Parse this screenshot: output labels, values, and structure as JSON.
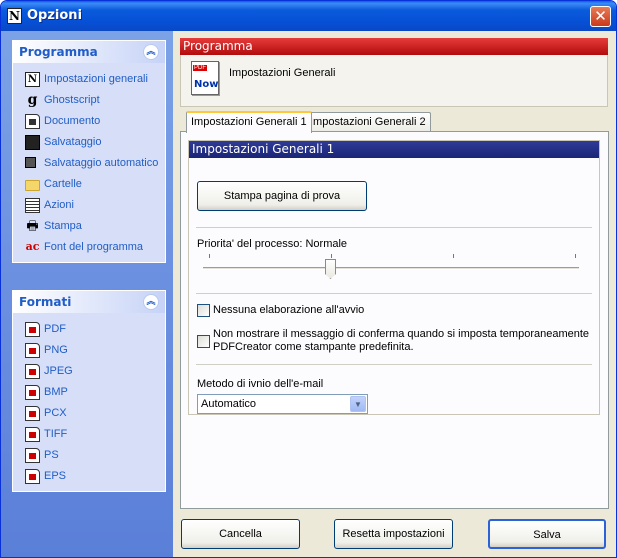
{
  "window": {
    "title": "Opzioni",
    "app_icon_glyph": "N",
    "close_glyph": "✕"
  },
  "nav": {
    "programma": {
      "title": "Programma",
      "items": [
        {
          "label": "Impostazioni generali",
          "icon": "document-n-icon"
        },
        {
          "label": "Ghostscript",
          "icon": "ghostscript-icon"
        },
        {
          "label": "Documento",
          "icon": "document-icon"
        },
        {
          "label": "Salvataggio",
          "icon": "floppy-disk-icon"
        },
        {
          "label": "Salvataggio automatico",
          "icon": "auto-save-icon"
        },
        {
          "label": "Cartelle",
          "icon": "folder-icon"
        },
        {
          "label": "Azioni",
          "icon": "actions-icon"
        },
        {
          "label": "Stampa",
          "icon": "printer-icon"
        },
        {
          "label": "Font del programma",
          "icon": "font-icon"
        }
      ]
    },
    "formati": {
      "title": "Formati",
      "items": [
        {
          "label": "PDF",
          "color": "#cc0000"
        },
        {
          "label": "PNG",
          "color": "#cc0000"
        },
        {
          "label": "JPEG",
          "color": "#cc0000"
        },
        {
          "label": "BMP",
          "color": "#cc0000"
        },
        {
          "label": "PCX",
          "color": "#cc0000"
        },
        {
          "label": "TIFF",
          "color": "#cc0000"
        },
        {
          "label": "PS",
          "color": "#cc0000"
        },
        {
          "label": "EPS",
          "color": "#cc0000"
        }
      ]
    }
  },
  "content": {
    "section_title": "Programma",
    "section_subtitle": "Impostazioni Generali",
    "icon_tag": "PDF",
    "icon_text": "Now",
    "tabs": [
      "Impostazioni Generali 1",
      "Impostazioni Generali 2"
    ],
    "group_title": "Impostazioni Generali 1",
    "print_test_button": "Stampa pagina di prova",
    "priority_label": "Priorita' del processo: Normale",
    "priority_level_percent": 35,
    "checkbox1_label": "Nessuna elaborazione all'avvio",
    "checkbox1_checked": false,
    "checkbox2_label_line1": "Non mostrare il messaggio di conferma quando si imposta temporaneamente",
    "checkbox2_label_line2": "PDFCreator come stampante predefinita.",
    "checkbox2_checked": false,
    "email_method_label": "Metodo di ivnio dell'e-mail",
    "email_method_value": "Automatico"
  },
  "footer": {
    "cancel": "Cancella",
    "reset": "Resetta impostazioni",
    "save": "Salva"
  }
}
